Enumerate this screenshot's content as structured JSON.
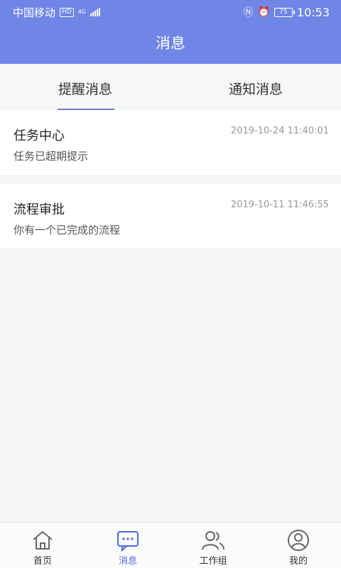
{
  "status_bar": {
    "carrier": "中国移动",
    "hd_badge": "HD",
    "network": "4G",
    "battery": "75",
    "time": "10:53",
    "icons": [
      "signal-icon",
      "nfc-icon",
      "alarm-icon",
      "battery-icon"
    ]
  },
  "header": {
    "title": "消息"
  },
  "tabs": [
    {
      "label": "提醒消息",
      "active": true
    },
    {
      "label": "通知消息",
      "active": false
    }
  ],
  "messages": [
    {
      "title": "任务中心",
      "time": "2019-10-24 11:40:01",
      "subtitle": "任务已超期提示"
    },
    {
      "title": "流程审批",
      "time": "2019-10-11 11:46:55",
      "subtitle": "你有一个已完成的流程"
    }
  ],
  "bottom_nav": [
    {
      "label": "首页",
      "icon": "home-icon",
      "active": false
    },
    {
      "label": "消息",
      "icon": "message-icon",
      "active": true
    },
    {
      "label": "工作组",
      "icon": "group-icon",
      "active": false
    },
    {
      "label": "我的",
      "icon": "profile-icon",
      "active": false
    }
  ],
  "colors": {
    "primary": "#6f86e6",
    "accent": "#4e68d6",
    "background": "#f4f5f6"
  }
}
